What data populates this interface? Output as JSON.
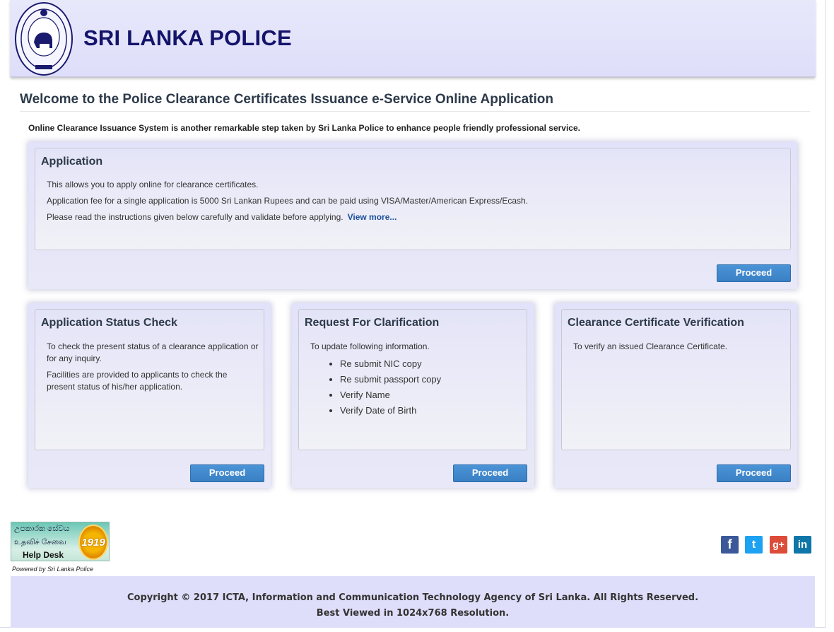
{
  "header": {
    "title": "SRI LANKA POLICE",
    "logo_icon": "police-emblem-icon"
  },
  "welcome": "Welcome to the Police Clearance Certificates Issuance e-Service Online Application",
  "intro": "Online Clearance Issuance System is another remarkable step taken by Sri Lanka Police to enhance people friendly professional service.",
  "application": {
    "title": "Application",
    "line1": "This allows you to apply online for clearance certificates.",
    "line2": "Application fee for a single application is 5000 Sri Lankan Rupees and can be paid using VISA/Master/American Express/Ecash.",
    "line3": "Please read the instructions given below carefully and validate before applying.",
    "link": "View more...",
    "button": "Proceed"
  },
  "status": {
    "title": "Application Status Check",
    "p1": "To check the present status of a clearance application or for any inquiry.",
    "p2": "Facilities are provided to applicants to check the present status of his/her application.",
    "button": "Proceed"
  },
  "clarification": {
    "title": "Request For Clarification",
    "intro": "To update following information.",
    "items": [
      "Re submit NIC copy",
      "Re submit passport copy",
      "Verify Name",
      "Verify Date of Birth"
    ],
    "button": "Proceed"
  },
  "verification": {
    "title": "Clearance Certificate Verification",
    "p1": "To verify an issued Clearance Certificate.",
    "button": "Proceed"
  },
  "helpdesk": {
    "script1": "උපකාරක සේවය",
    "script2": "உதவிச் சேவை",
    "label": "Help Desk",
    "number": "1919",
    "powered": "Powered by Sri Lanka Police"
  },
  "social": {
    "facebook": "f",
    "twitter": "t",
    "googleplus": "g+",
    "linkedin": "in"
  },
  "footer": {
    "copyright": "Copyright © 2017 ICTA, Information and Communication Technology Agency of Sri Lanka. All Rights Reserved.",
    "resolution": "Best Viewed in 1024x768 Resolution."
  },
  "colors": {
    "header_bg": "#dedefa",
    "title": "#14146b",
    "button": "#3f86cb",
    "link": "#1b4f9c"
  }
}
